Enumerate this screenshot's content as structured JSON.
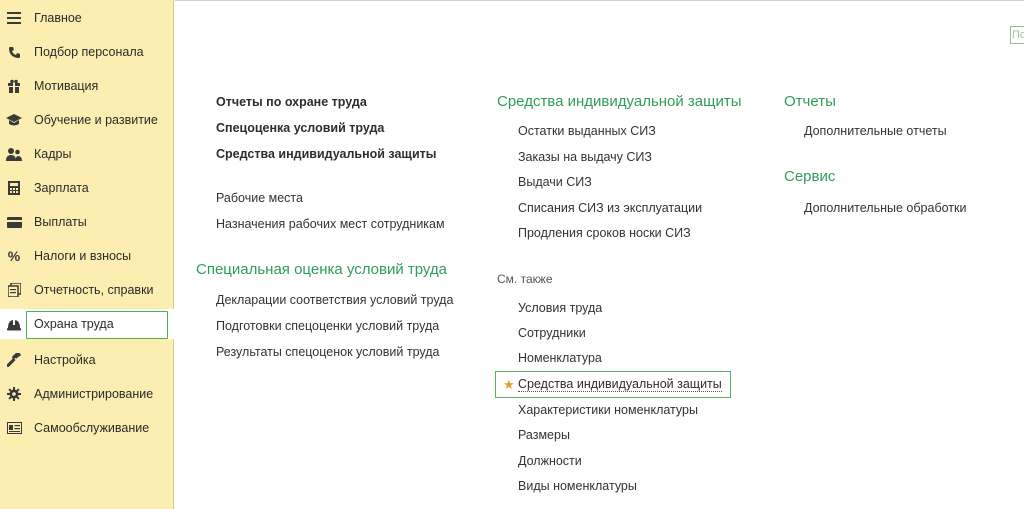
{
  "sidebar": {
    "items": [
      {
        "label": "Главное",
        "icon": "menu-icon"
      },
      {
        "label": "Подбор персонала",
        "icon": "phone-icon"
      },
      {
        "label": "Мотивация",
        "icon": "gift-icon"
      },
      {
        "label": "Обучение и развитие",
        "icon": "graduation-cap-icon"
      },
      {
        "label": "Кадры",
        "icon": "users-icon"
      },
      {
        "label": "Зарплата",
        "icon": "calculator-icon"
      },
      {
        "label": "Выплаты",
        "icon": "card-icon"
      },
      {
        "label": "Налоги и взносы",
        "icon": "percent-icon"
      },
      {
        "label": "Отчетность, справки",
        "icon": "reports-icon"
      },
      {
        "label": "Охрана труда",
        "icon": "helmet-icon"
      },
      {
        "label": "Настройка",
        "icon": "wrench-icon"
      },
      {
        "label": "Администрирование",
        "icon": "gear-icon"
      },
      {
        "label": "Самообслуживание",
        "icon": "id-card-icon"
      }
    ],
    "active_index": 9
  },
  "search": {
    "placeholder": "По"
  },
  "column1": {
    "bold_links": [
      "Отчеты по охране труда",
      "Спецоценка условий труда",
      "Средства индивидуальной защиты"
    ],
    "links": [
      "Рабочие места",
      "Назначения рабочих мест сотрудникам"
    ],
    "section_title": "Специальная оценка условий труда",
    "section_links": [
      "Декларации соответствия условий труда",
      "Подготовки спецоценки условий труда",
      "Результаты спецоценок условий труда"
    ]
  },
  "column2": {
    "section_title": "Средства индивидуальной защиты",
    "links": [
      "Остатки выданных СИЗ",
      "Заказы на выдачу СИЗ",
      "Выдачи СИЗ",
      "Списания СИЗ из эксплуатации",
      "Продления сроков носки СИЗ"
    ],
    "see_also_title": "См. также",
    "see_also_links": [
      "Условия труда",
      "Сотрудники",
      "Номенклатура"
    ],
    "favorite_link": "Средства индивидуальной защиты",
    "more_links": [
      "Характеристики номенклатуры",
      "Размеры",
      "Должности",
      "Виды номенклатуры"
    ]
  },
  "column3": {
    "reports_title": "Отчеты",
    "reports_links": [
      "Дополнительные отчеты"
    ],
    "service_title": "Сервис",
    "service_links": [
      "Дополнительные обработки"
    ]
  },
  "colors": {
    "sidebar_bg": "#fbeeb0",
    "section_green": "#2e9e57",
    "active_border": "#4caf50",
    "star": "#e89b2e"
  }
}
